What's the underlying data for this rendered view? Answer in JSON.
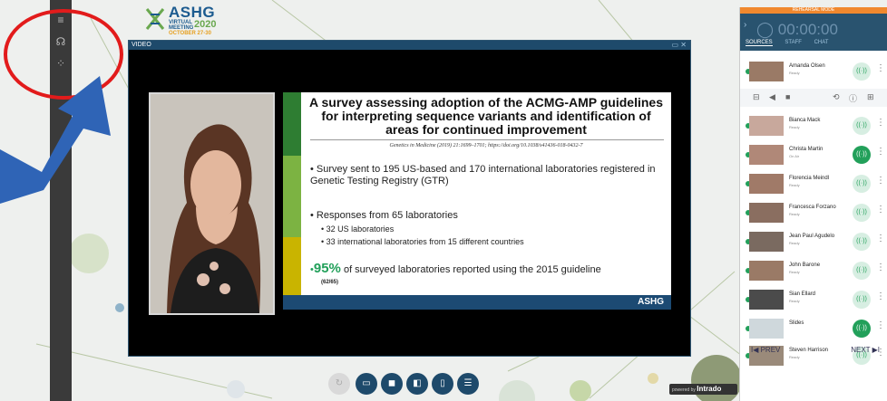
{
  "logo": {
    "title": "ASHG",
    "line1": "VIRTUAL",
    "line2": "MEETING",
    "year": "2020",
    "date": "OCTOBER 27-30"
  },
  "video": {
    "title": "VIDEO"
  },
  "slide": {
    "title": "A survey assessing adoption of the ACMG-AMP guidelines for interpreting sequence variants and identification of areas for continued improvement",
    "citation": "Genetics in Medicine (2019) 21:1699–1701; https://doi.org/10.1038/s41436-018-0432-7",
    "b1": "• Survey sent to 195 US-based and 170 international laboratories registered in Genetic Testing Registry (GTR)",
    "b2": "• Responses from 65 laboratories",
    "sb1": "• 32 US laboratories",
    "sb2": "• 33 international laboratories from 15 different countries",
    "pct": "95%",
    "b3": " of surveyed laboratories reported using the 2015 guideline",
    "small": "(62/65)",
    "footer": "ASHG"
  },
  "panel": {
    "rehearsal": "REHEARSAL MODE",
    "timer": "00:00:00",
    "tabs": [
      "SOURCES",
      "STAFF",
      "CHAT"
    ],
    "first": {
      "name": "Amanda Olsen",
      "status": "Ready"
    },
    "sources": [
      {
        "name": "Bianca Mack",
        "status": "Ready",
        "on": false
      },
      {
        "name": "Christa Martin",
        "status": "On Air",
        "on": true
      },
      {
        "name": "Florencia Meindl",
        "status": "Ready",
        "on": false
      },
      {
        "name": "Francesca Forzano",
        "status": "Ready",
        "on": false
      },
      {
        "name": "Jean Paul Agudelo",
        "status": "Ready",
        "on": false
      },
      {
        "name": "John Barone",
        "status": "Ready",
        "on": false
      },
      {
        "name": "Sian Ellard",
        "status": "Ready",
        "on": false
      },
      {
        "name": "Slides",
        "status": "",
        "on": true
      },
      {
        "name": "Steven Harrison",
        "status": "Ready",
        "on": false
      }
    ],
    "prev": "I◀ PREV",
    "next": "NEXT ▶I"
  },
  "powered": {
    "text": "powered by",
    "brand": "Intrado"
  }
}
